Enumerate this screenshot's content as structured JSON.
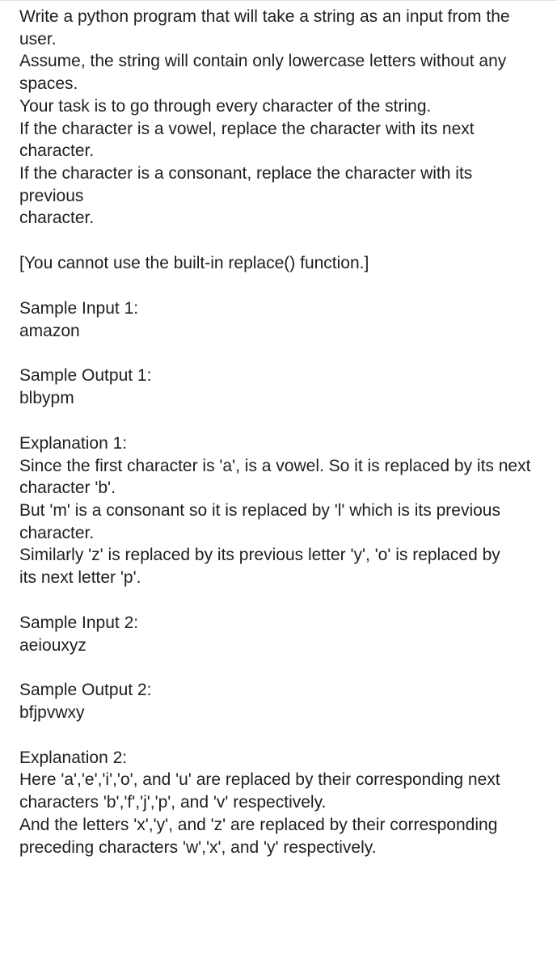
{
  "intro": {
    "l1": "Write a python program that will take a string as an input from the user.",
    "l2": "Assume, the string will contain only lowercase letters without any spaces.",
    "l3": "Your task is to go through every character of the string.",
    "l4": "If the character is a vowel, replace the character with its next character.",
    "l5": "If the character is a consonant, replace the character with its previous",
    "l6": "character."
  },
  "note": "[You cannot use the built-in replace() function.]",
  "sample1": {
    "inLabel": "Sample Input 1:",
    "inVal": "amazon",
    "outLabel": "Sample Output 1:",
    "outVal": "blbypm"
  },
  "exp1": {
    "title": "Explanation 1:",
    "l1": "Since the first character is 'a', is a vowel. So it is replaced by its next",
    "l2": "character 'b'.",
    "l3": "But 'm' is a consonant so it is replaced by 'l' which is its previous",
    "l4": "character.",
    "l5": "Similarly 'z' is replaced by its previous letter 'y', 'o' is replaced by",
    "l6": "its next letter 'p'."
  },
  "sample2": {
    "inLabel": "Sample Input 2:",
    "inVal": "aeiouxyz",
    "outLabel": "Sample Output 2:",
    "outVal": "bfjpvwxy"
  },
  "exp2": {
    "title": "Explanation 2:",
    "l1": "Here 'a','e','i','o', and 'u' are replaced by their corresponding next",
    "l2": "characters 'b','f','j','p', and 'v' respectively.",
    "l3": "And the letters 'x','y', and 'z' are replaced by their corresponding",
    "l4": "preceding characters 'w','x', and 'y' respectively."
  }
}
